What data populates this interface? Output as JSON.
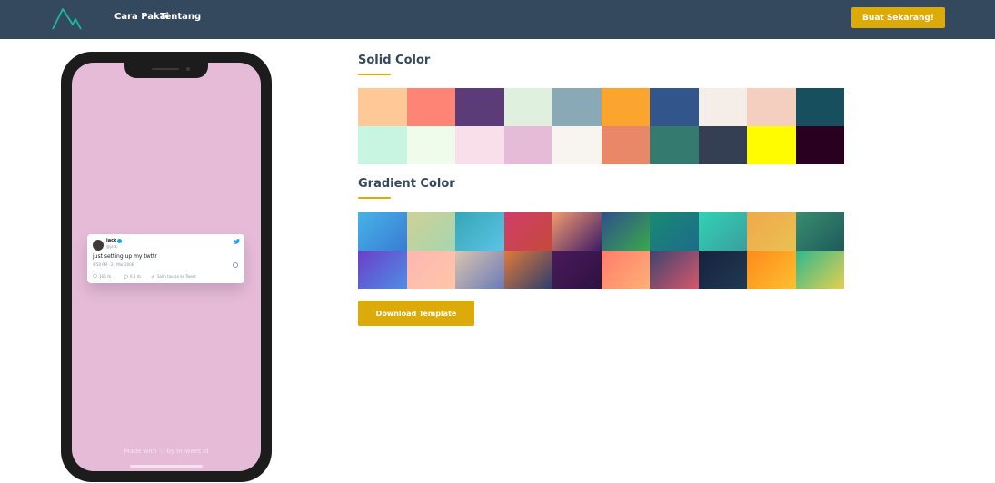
{
  "nav": {
    "links": [
      "Cara Pakai",
      "Tentang"
    ],
    "cta_label": "Buat Sekarang!"
  },
  "phone": {
    "background_color": "#e6bbd8",
    "footer_text": "Made with ♡ by InTweet.id"
  },
  "tweet": {
    "name": "jack",
    "handle": "@jack",
    "text": "just setting up my twttr",
    "timestamp": "9:50 PM · 21 Mar 2006",
    "likes": "166 rb",
    "replies": "6,3 rb",
    "copy_link_label": "Salin tautan ke Tweet"
  },
  "solid_section": {
    "title": "Solid Color",
    "colors": [
      "#fec997",
      "#fe8575",
      "#5b3b78",
      "#e0f0df",
      "#88a9b5",
      "#fca52e",
      "#32558c",
      "#f4ede8",
      "#f4cebe",
      "#174f5e",
      "#c7f5e1",
      "#effbeb",
      "#f8dfea",
      "#e6bbd8",
      "#f8f5f1",
      "#e98868",
      "#357a6e",
      "#343f54",
      "#fffc00",
      "#290020"
    ]
  },
  "gradient_section": {
    "title": "Gradient Color",
    "gradients": [
      [
        "#46b3e6",
        "#3a7bd5"
      ],
      [
        "#d0d096",
        "#a5d6b0"
      ],
      [
        "#36a6b8",
        "#5bc4e5"
      ],
      [
        "#d13d6a",
        "#c44a3a"
      ],
      [
        "#f29b6f",
        "#3d1b66"
      ],
      [
        "#2f4f8a",
        "#3aa84c"
      ],
      [
        "#188a73",
        "#1e6b8a"
      ],
      [
        "#2fd3b4",
        "#3c9e9f"
      ],
      [
        "#f1a84b",
        "#e9c152"
      ],
      [
        "#3a8c70",
        "#1d5a5a"
      ],
      [
        "#6a3fc7",
        "#4f8ee6"
      ],
      [
        "#fcb6b2",
        "#ffc7a8"
      ],
      [
        "#d9c5b0",
        "#6b7bb8"
      ],
      [
        "#e27a3a",
        "#2a3e6b"
      ],
      [
        "#4a1a5a",
        "#2d1242"
      ],
      [
        "#ff7c6b",
        "#ffb076"
      ],
      [
        "#3d4470",
        "#d7576b"
      ],
      [
        "#15213d",
        "#203a52"
      ],
      [
        "#fd8a1b",
        "#ffc030"
      ],
      [
        "#2fb88c",
        "#e4d04e"
      ]
    ]
  },
  "download_label": "Download Template",
  "colors": {
    "navbar": "#34495e",
    "accent": "#dcab09",
    "logo": "#1abc9c"
  }
}
